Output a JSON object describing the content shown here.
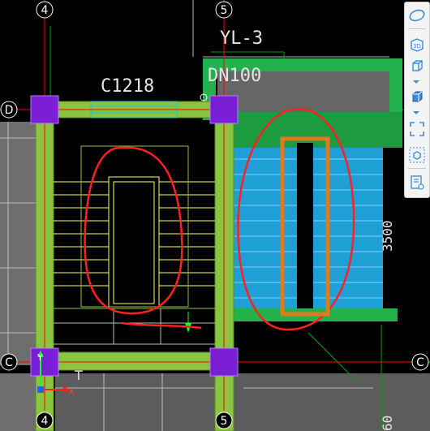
{
  "drawing": {
    "axis_labels": {
      "top_left_col": "4",
      "top_right_col": "5",
      "bottom_left_col": "4",
      "bottom_right_col": "5",
      "row_d": "D",
      "row_c_left": "C",
      "row_c_right": "C"
    },
    "beam_label": "YL-3",
    "pipe_label": "DN100",
    "window_label": "C1218",
    "dimension_label": "3500",
    "dimension_label_bottom": "60",
    "ucs": {
      "x_label": "X",
      "y_label": "Y"
    },
    "colors": {
      "background": "#000000",
      "slab_green": "#8bc53f",
      "wall_green": "#22b14c",
      "column_purple": "#7b1fd6",
      "stair_yellow": "#ffff66",
      "blue_stair": "#1e9fd6",
      "axis_red": "#ff0000",
      "markup_red": "#ff2020",
      "orange_box": "#e07a1f",
      "grid_green": "#00a000",
      "gray_fill": "#7a7a7a"
    }
  },
  "toolbar": {
    "buttons": [
      {
        "name": "orbit-icon",
        "label": ""
      },
      {
        "name": "3d-view-icon",
        "label": "3D"
      },
      {
        "name": "view-cube-icon",
        "label": ""
      },
      {
        "name": "box-view-icon",
        "label": ""
      },
      {
        "name": "fit-extents-icon",
        "label": ""
      },
      {
        "name": "isolate-icon",
        "label": ""
      },
      {
        "name": "properties-icon",
        "label": ""
      }
    ]
  }
}
